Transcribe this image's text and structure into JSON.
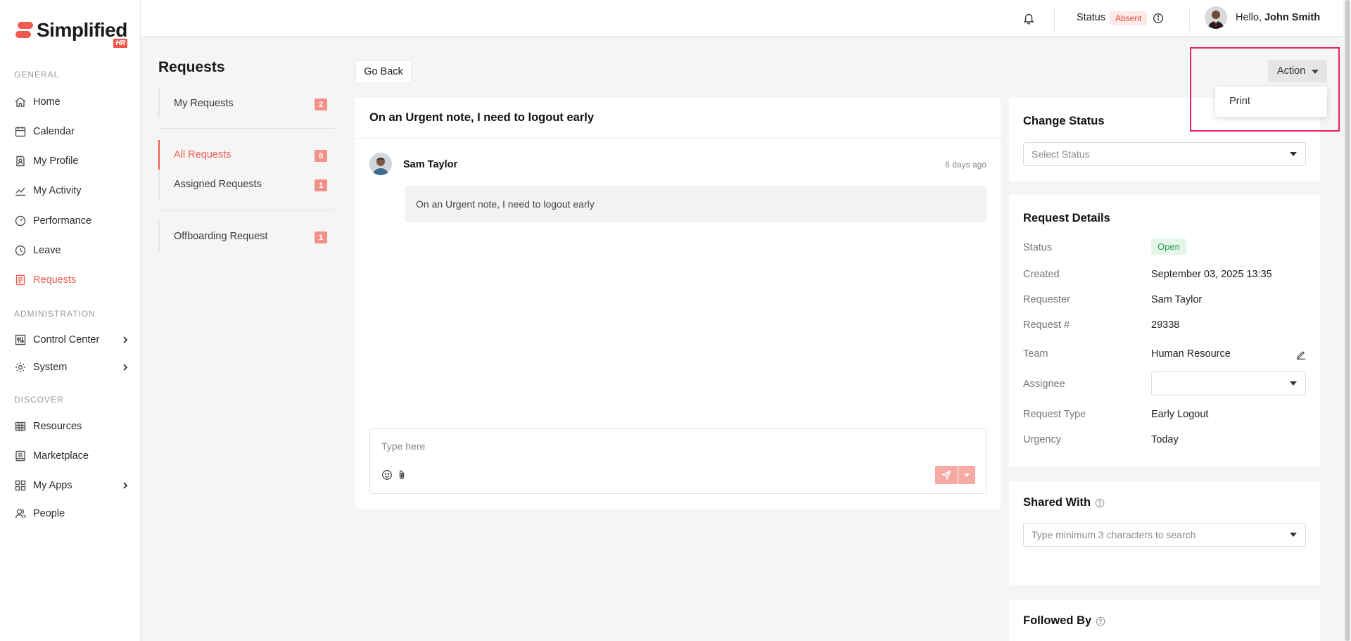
{
  "brand": {
    "name": "Simplified",
    "sub": "HR"
  },
  "sidebar": {
    "sections": [
      "GENERAL",
      "ADMINISTRATION",
      "DISCOVER"
    ],
    "general": [
      {
        "label": "Home",
        "icon": "home-icon"
      },
      {
        "label": "Calendar",
        "icon": "calendar-icon"
      },
      {
        "label": "My Profile",
        "icon": "profile-icon"
      },
      {
        "label": "My Activity",
        "icon": "activity-icon"
      },
      {
        "label": "Performance",
        "icon": "performance-icon"
      },
      {
        "label": "Leave",
        "icon": "clock-icon"
      },
      {
        "label": "Requests",
        "icon": "requests-icon",
        "active": true
      }
    ],
    "administration": [
      {
        "label": "Control Center",
        "icon": "sliders-icon"
      },
      {
        "label": "System",
        "icon": "gear-icon"
      }
    ],
    "discover": [
      {
        "label": "Resources",
        "icon": "grid-icon"
      },
      {
        "label": "Marketplace",
        "icon": "store-icon"
      },
      {
        "label": "My Apps",
        "icon": "apps-icon"
      },
      {
        "label": "People",
        "icon": "people-icon"
      }
    ]
  },
  "topbar": {
    "status_label": "Status",
    "status_value": "Absent",
    "hello": "Hello,",
    "user_name": "John Smith"
  },
  "requests": {
    "title": "Requests",
    "groups": [
      [
        {
          "label": "My Requests",
          "count": "2"
        }
      ],
      [
        {
          "label": "All Requests",
          "count": "8",
          "active": true
        },
        {
          "label": "Assigned Requests",
          "count": "1"
        }
      ],
      [
        {
          "label": "Offboarding Request",
          "count": "1"
        }
      ]
    ]
  },
  "go_back": "Go Back",
  "action": {
    "label": "Action",
    "menu": [
      "Print"
    ]
  },
  "thread": {
    "title": "On an Urgent note, I need to logout early",
    "author": "Sam Taylor",
    "time": "6 days ago",
    "message": "On an Urgent note, I need to logout early",
    "composer_placeholder": "Type here"
  },
  "change_status": {
    "title": "Change Status",
    "placeholder": "Select Status"
  },
  "details": {
    "title": "Request Details",
    "status_label": "Status",
    "status_value": "Open",
    "created_label": "Created",
    "created_value": "September 03, 2025 13:35",
    "requester_label": "Requester",
    "requester_value": "Sam Taylor",
    "request_no_label": "Request #",
    "request_no_value": "29338",
    "team_label": "Team",
    "team_value": "Human Resource",
    "assignee_label": "Assignee",
    "assignee_value": "",
    "type_label": "Request Type",
    "type_value": "Early Logout",
    "urgency_label": "Urgency",
    "urgency_value": "Today"
  },
  "shared_with": {
    "title": "Shared With",
    "placeholder": "Type minimum 3 characters to search"
  },
  "followed_by": {
    "title": "Followed By"
  },
  "colors": {
    "accent": "#ef5a4f",
    "highlight": "#e5245e",
    "open_green": "#2e9a52"
  }
}
